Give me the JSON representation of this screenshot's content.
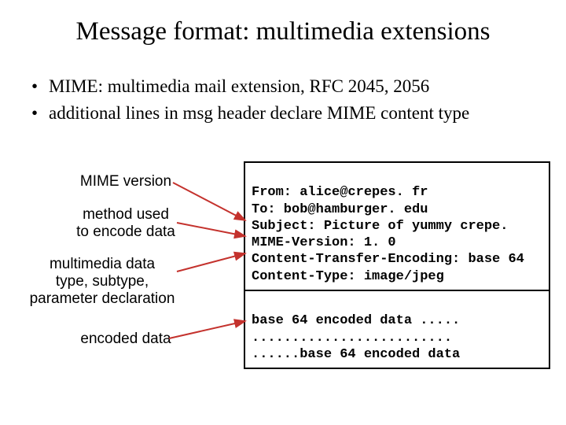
{
  "title": "Message format: multimedia extensions",
  "bullets": [
    "MIME: multimedia mail extension, RFC 2045, 2056",
    "additional lines in msg header declare MIME content type"
  ],
  "labels": {
    "mime_version": "MIME version",
    "method_line1": "method used",
    "method_line2": "to encode data",
    "multimedia_line1": "multimedia data",
    "multimedia_line2": "type, subtype,",
    "multimedia_line3": "parameter declaration",
    "encoded_data": "encoded data"
  },
  "header_lines": [
    "From: alice@crepes. fr",
    "To: bob@hamburger. edu",
    "Subject: Picture of yummy crepe.",
    "MIME-Version: 1. 0",
    "Content-Transfer-Encoding: base 64",
    "Content-Type: image/jpeg"
  ],
  "body_lines": [
    "base 64 encoded data .....",
    ".........................",
    "......base 64 encoded data"
  ],
  "colors": {
    "arrow": "#c4322d"
  }
}
